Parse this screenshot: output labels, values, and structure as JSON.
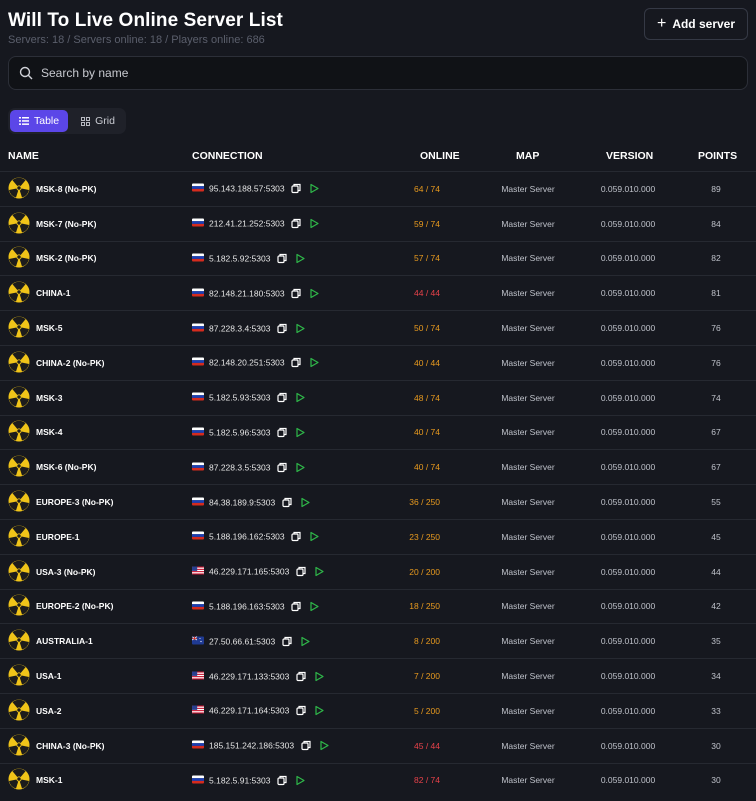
{
  "header": {
    "title": "Will To Live Online Server List",
    "stats": "Servers: 18  /  Servers online: 18  /  Players online: 686",
    "add_label": "Add server"
  },
  "search": {
    "placeholder": "Search by name"
  },
  "view_toggle": {
    "table_label": "Table",
    "grid_label": "Grid",
    "active": "Table"
  },
  "columns": {
    "name": "NAME",
    "connection": "CONNECTION",
    "online": "ONLINE",
    "map": "MAP",
    "version": "VERSION",
    "points": "POINTS"
  },
  "colors": {
    "accent": "#5b46e8",
    "online_ok": "#e89a1f",
    "online_full": "#e8424a",
    "play": "#2fb84a",
    "logo_yellow": "#f0c419"
  },
  "servers": [
    {
      "name": "MSK-8 (No-PK)",
      "flag": "ru",
      "connection": "95.143.188.57:5303",
      "online": "64 / 74",
      "status": "ok",
      "map": "Master Server",
      "version": "0.059.010.000",
      "points": "89"
    },
    {
      "name": "MSK-7 (No-PK)",
      "flag": "ru",
      "connection": "212.41.21.252:5303",
      "online": "59 / 74",
      "status": "ok",
      "map": "Master Server",
      "version": "0.059.010.000",
      "points": "84"
    },
    {
      "name": "MSK-2 (No-PK)",
      "flag": "ru",
      "connection": "5.182.5.92:5303",
      "online": "57 / 74",
      "status": "ok",
      "map": "Master Server",
      "version": "0.059.010.000",
      "points": "82"
    },
    {
      "name": "CHINA-1",
      "flag": "ru",
      "connection": "82.148.21.180:5303",
      "online": "44 / 44",
      "status": "full",
      "map": "Master Server",
      "version": "0.059.010.000",
      "points": "81"
    },
    {
      "name": "MSK-5",
      "flag": "ru",
      "connection": "87.228.3.4:5303",
      "online": "50 / 74",
      "status": "ok",
      "map": "Master Server",
      "version": "0.059.010.000",
      "points": "76"
    },
    {
      "name": "CHINA-2 (No-PK)",
      "flag": "ru",
      "connection": "82.148.20.251:5303",
      "online": "40 / 44",
      "status": "ok",
      "map": "Master Server",
      "version": "0.059.010.000",
      "points": "76"
    },
    {
      "name": "MSK-3",
      "flag": "ru",
      "connection": "5.182.5.93:5303",
      "online": "48 / 74",
      "status": "ok",
      "map": "Master Server",
      "version": "0.059.010.000",
      "points": "74"
    },
    {
      "name": "MSK-4",
      "flag": "ru",
      "connection": "5.182.5.96:5303",
      "online": "40 / 74",
      "status": "ok",
      "map": "Master Server",
      "version": "0.059.010.000",
      "points": "67"
    },
    {
      "name": "MSK-6 (No-PK)",
      "flag": "ru",
      "connection": "87.228.3.5:5303",
      "online": "40 / 74",
      "status": "ok",
      "map": "Master Server",
      "version": "0.059.010.000",
      "points": "67"
    },
    {
      "name": "EUROPE-3 (No-PK)",
      "flag": "ru",
      "connection": "84.38.189.9:5303",
      "online": "36 / 250",
      "status": "ok",
      "map": "Master Server",
      "version": "0.059.010.000",
      "points": "55"
    },
    {
      "name": "EUROPE-1",
      "flag": "ru",
      "connection": "5.188.196.162:5303",
      "online": "23 / 250",
      "status": "ok",
      "map": "Master Server",
      "version": "0.059.010.000",
      "points": "45"
    },
    {
      "name": "USA-3 (No-PK)",
      "flag": "us",
      "connection": "46.229.171.165:5303",
      "online": "20 / 200",
      "status": "ok",
      "map": "Master Server",
      "version": "0.059.010.000",
      "points": "44"
    },
    {
      "name": "EUROPE-2 (No-PK)",
      "flag": "ru",
      "connection": "5.188.196.163:5303",
      "online": "18 / 250",
      "status": "ok",
      "map": "Master Server",
      "version": "0.059.010.000",
      "points": "42"
    },
    {
      "name": "AUSTRALIA-1",
      "flag": "au",
      "connection": "27.50.66.61:5303",
      "online": "8 / 200",
      "status": "ok",
      "map": "Master Server",
      "version": "0.059.010.000",
      "points": "35"
    },
    {
      "name": "USA-1",
      "flag": "us",
      "connection": "46.229.171.133:5303",
      "online": "7 / 200",
      "status": "ok",
      "map": "Master Server",
      "version": "0.059.010.000",
      "points": "34"
    },
    {
      "name": "USA-2",
      "flag": "us",
      "connection": "46.229.171.164:5303",
      "online": "5 / 200",
      "status": "ok",
      "map": "Master Server",
      "version": "0.059.010.000",
      "points": "33"
    },
    {
      "name": "CHINA-3 (No-PK)",
      "flag": "ru",
      "connection": "185.151.242.186:5303",
      "online": "45 / 44",
      "status": "full",
      "map": "Master Server",
      "version": "0.059.010.000",
      "points": "30"
    },
    {
      "name": "MSK-1",
      "flag": "ru",
      "connection": "5.182.5.91:5303",
      "online": "82 / 74",
      "status": "full",
      "map": "Master Server",
      "version": "0.059.010.000",
      "points": "30"
    }
  ]
}
